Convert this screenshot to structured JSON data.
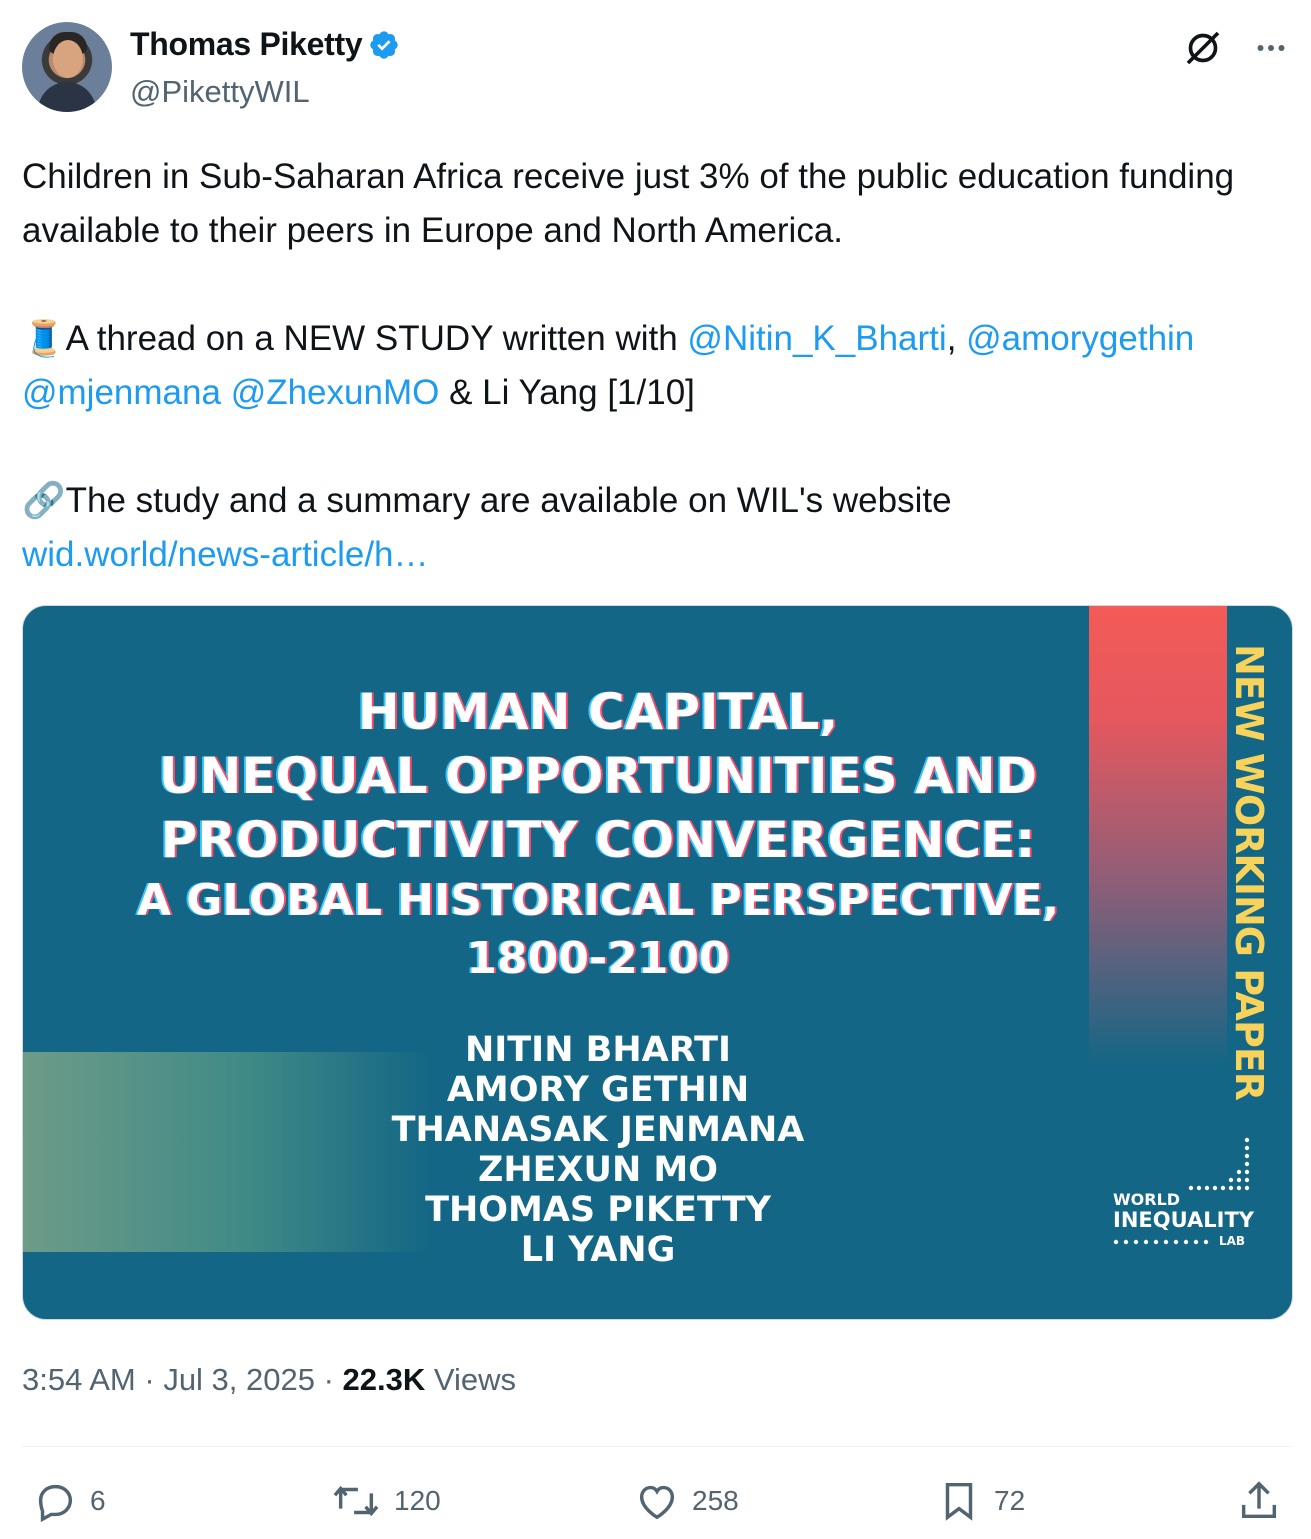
{
  "author": {
    "name": "Thomas Piketty",
    "handle": "@PikettyWIL",
    "verified_icon": "verified-badge-icon",
    "avatar_icon": "profile-avatar"
  },
  "header_icons": [
    "grok-icon",
    "more-options-icon"
  ],
  "tweet": {
    "line1": "Children in Sub-Saharan Africa receive just 3% of the public education funding available to their peers in Europe and North America.",
    "thread_emoji": "🧵",
    "thread_text": "A thread on a NEW STUDY written with ",
    "mention1": "@Nitin_K_Bharti",
    "comma": ", ",
    "mention2": "@amorygethin",
    "mention3": "@mjenmana",
    "mention4": "@ZhexunMO",
    "thread_tail": " & Li Yang [1/10]",
    "link_emoji": "🔗",
    "study_text": "The study and a summary are available on WIL's website",
    "link": "wid.world/news-article/h…"
  },
  "card": {
    "title_line1": "HUMAN CAPITAL,",
    "title_line2": "UNEQUAL OPPORTUNITIES AND",
    "title_line3": "PRODUCTIVITY CONVERGENCE:",
    "title_line4": "A GLOBAL HISTORICAL PERSPECTIVE,",
    "title_line5": "1800-2100",
    "authors": [
      "NITIN BHARTI",
      "AMORY GETHIN",
      "THANASAK JENMANA",
      "ZHEXUN MO",
      "THOMAS PIKETTY",
      "LI YANG"
    ],
    "vertical_label": "NEW WORKING PAPER",
    "logo_line1": "WORLD",
    "logo_line2": "INEQUALITY",
    "logo_line3": "LAB",
    "colors": {
      "background": "#136685",
      "accent_red": "#f45a57",
      "accent_yellow": "#f7d35c",
      "accent_green": "#6d9b88"
    }
  },
  "meta": {
    "time": "3:54 AM",
    "sep1": " · ",
    "date": "Jul 3, 2025",
    "sep2": " · ",
    "views_count": "22.3K",
    "views_label": " Views"
  },
  "actions": {
    "replies": "6",
    "reposts": "120",
    "likes": "258",
    "bookmarks": "72",
    "icons": [
      "reply-icon",
      "repost-icon",
      "like-icon",
      "bookmark-icon",
      "share-icon"
    ]
  },
  "colors": {
    "link": "#1d9bf0",
    "secondary_text": "#536471",
    "primary_text": "#0f1419"
  }
}
